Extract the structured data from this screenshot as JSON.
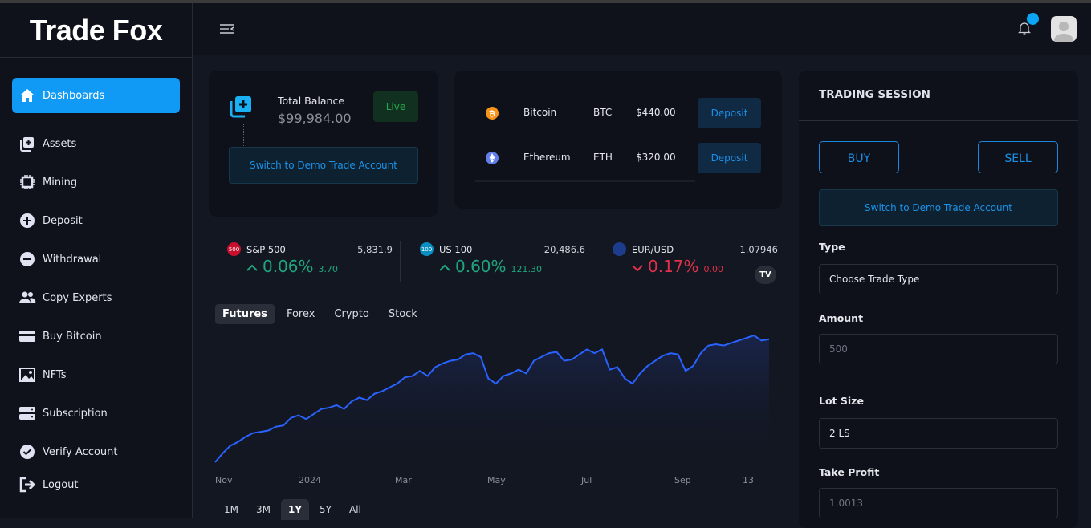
{
  "brand": "Trade Fox",
  "sidebar": {
    "items": [
      {
        "label": "Dashboards",
        "icon": "home-icon",
        "active": true
      },
      {
        "label": "Assets",
        "icon": "copy-plus-icon"
      },
      {
        "label": "Mining",
        "icon": "chip-icon"
      },
      {
        "label": "Deposit",
        "icon": "plus-circle-icon"
      },
      {
        "label": "Withdrawal",
        "icon": "minus-circle-icon"
      },
      {
        "label": "Copy Experts",
        "icon": "users-icon"
      },
      {
        "label": "Buy Bitcoin",
        "icon": "card-icon"
      },
      {
        "label": "NFTs",
        "icon": "image-icon"
      },
      {
        "label": "Subscription",
        "icon": "server-icon"
      },
      {
        "label": "Verify Account",
        "icon": "check-circle-icon"
      },
      {
        "label": "Logout",
        "icon": "logout-icon"
      }
    ]
  },
  "header": {
    "notification_dot_color": "#0ca4f4"
  },
  "balance": {
    "label": "Total Balance",
    "amount": "$99,984.00",
    "status": "Live",
    "switch_label": "Switch to Demo Trade Account"
  },
  "coins": [
    {
      "name": "Bitcoin",
      "symbol": "BTC",
      "amount": "$440.00",
      "action": "Deposit",
      "color": "#f7931a"
    },
    {
      "name": "Ethereum",
      "symbol": "ETH",
      "amount": "$320.00",
      "action": "Deposit",
      "color": "#627eea"
    }
  ],
  "tickers": [
    {
      "badge": "500",
      "name": "S&P 500",
      "value": "5,831.9",
      "pct": "0.06%",
      "change": "3.70",
      "dir": "up",
      "arrow": "^",
      "color": "#c8102e"
    },
    {
      "badge": "100",
      "name": "US 100",
      "value": "20,486.6",
      "pct": "0.60%",
      "change": "121.30",
      "dir": "up",
      "arrow": "^",
      "color": "#0a8fc2"
    },
    {
      "badge": "",
      "name": "EUR/USD",
      "value": "1.07946",
      "pct": "0.17%",
      "change": "0.00",
      "dir": "down",
      "arrow": "v",
      "color": "#1e3c8c"
    }
  ],
  "widget": {
    "logo": "TV",
    "tabs": [
      "Futures",
      "Forex",
      "Crypto",
      "Stock"
    ],
    "active_tab": "Futures",
    "ranges": [
      "1M",
      "3M",
      "1Y",
      "5Y",
      "All"
    ],
    "active_range": "1Y"
  },
  "chart_data": {
    "type": "area",
    "x_ticks": [
      "Nov",
      "2024",
      "Mar",
      "May",
      "Jul",
      "Sep",
      "13"
    ],
    "line_color": "#2962ff",
    "values": [
      0,
      7,
      13,
      16,
      20,
      23,
      24,
      25,
      28,
      29,
      35,
      37,
      34,
      38,
      42,
      43,
      45,
      42,
      48,
      51,
      49,
      54,
      56,
      59,
      62,
      67,
      68,
      72,
      68,
      75,
      78,
      80,
      81,
      85,
      86,
      83,
      66,
      62,
      68,
      70,
      73,
      70,
      80,
      83,
      86,
      87,
      80,
      81,
      85,
      89,
      86,
      89,
      73,
      75,
      66,
      62,
      70,
      76,
      80,
      84,
      86,
      85,
      72,
      76,
      86,
      92,
      93,
      92,
      94,
      96,
      98,
      100,
      96,
      97
    ]
  },
  "trading": {
    "title": "TRADING SESSION",
    "buy": "BUY",
    "sell": "SELL",
    "switch_label": "Switch to Demo Trade Account",
    "type_label": "Type",
    "type_value": "Choose Trade Type",
    "amount_label": "Amount",
    "amount_placeholder": "500",
    "lot_label": "Lot Size",
    "lot_value": "2 LS",
    "tp_label": "Take Profit",
    "tp_placeholder": "1.0013"
  }
}
